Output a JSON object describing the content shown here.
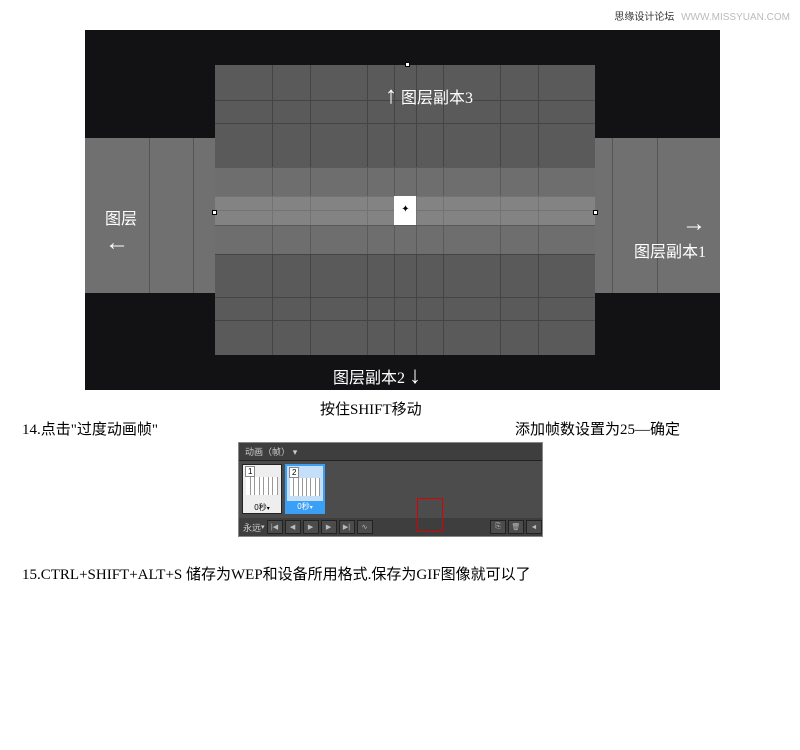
{
  "watermark": {
    "cn": "思缘设计论坛",
    "url": "WWW.MISSYUAN.COM"
  },
  "diagram": {
    "layer_left": "图层",
    "layer_right": "图层副本1",
    "layer_bottom": "图层副本2",
    "layer_top": "图层副本3"
  },
  "caption_shift": "按住SHIFT移动",
  "step14_left": "14.点击\"过度动画帧\"",
  "step14_right": "添加帧数设置为25—确定",
  "anim": {
    "header": "动画（帧）",
    "frame1_num": "1",
    "frame1_time": "0秒",
    "frame2_num": "2",
    "frame2_time": "0秒",
    "loop": "永远"
  },
  "step15": "15.CTRL+SHIFT+ALT+S 储存为WEP和设备所用格式.保存为GIF图像就可以了"
}
